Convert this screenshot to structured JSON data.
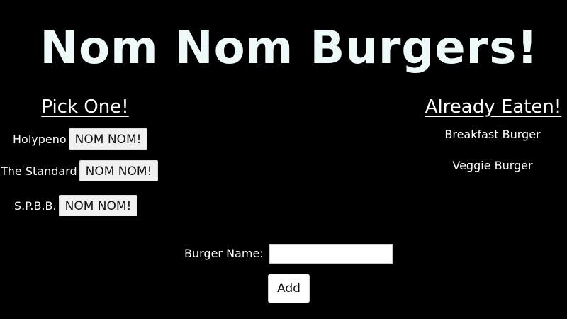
{
  "header": {
    "title": "Nom Nom Burgers!"
  },
  "pick_column": {
    "heading": "Pick One!",
    "items": [
      {
        "name": "Holypeno",
        "button_label": "NOM NOM!"
      },
      {
        "name": "The Standard",
        "button_label": "NOM NOM!"
      },
      {
        "name": "S.P.B.B.",
        "button_label": "NOM NOM!"
      }
    ]
  },
  "eaten_column": {
    "heading": "Already Eaten!",
    "items": [
      "Breakfast Burger",
      "Veggie Burger"
    ]
  },
  "form": {
    "label": "Burger Name:",
    "input_value": "",
    "input_placeholder": "",
    "submit_label": "Add"
  },
  "colors": {
    "background": "#000000",
    "title": "#eefafa",
    "text": "#ffffff",
    "button_bg": "#f0f0f0"
  }
}
